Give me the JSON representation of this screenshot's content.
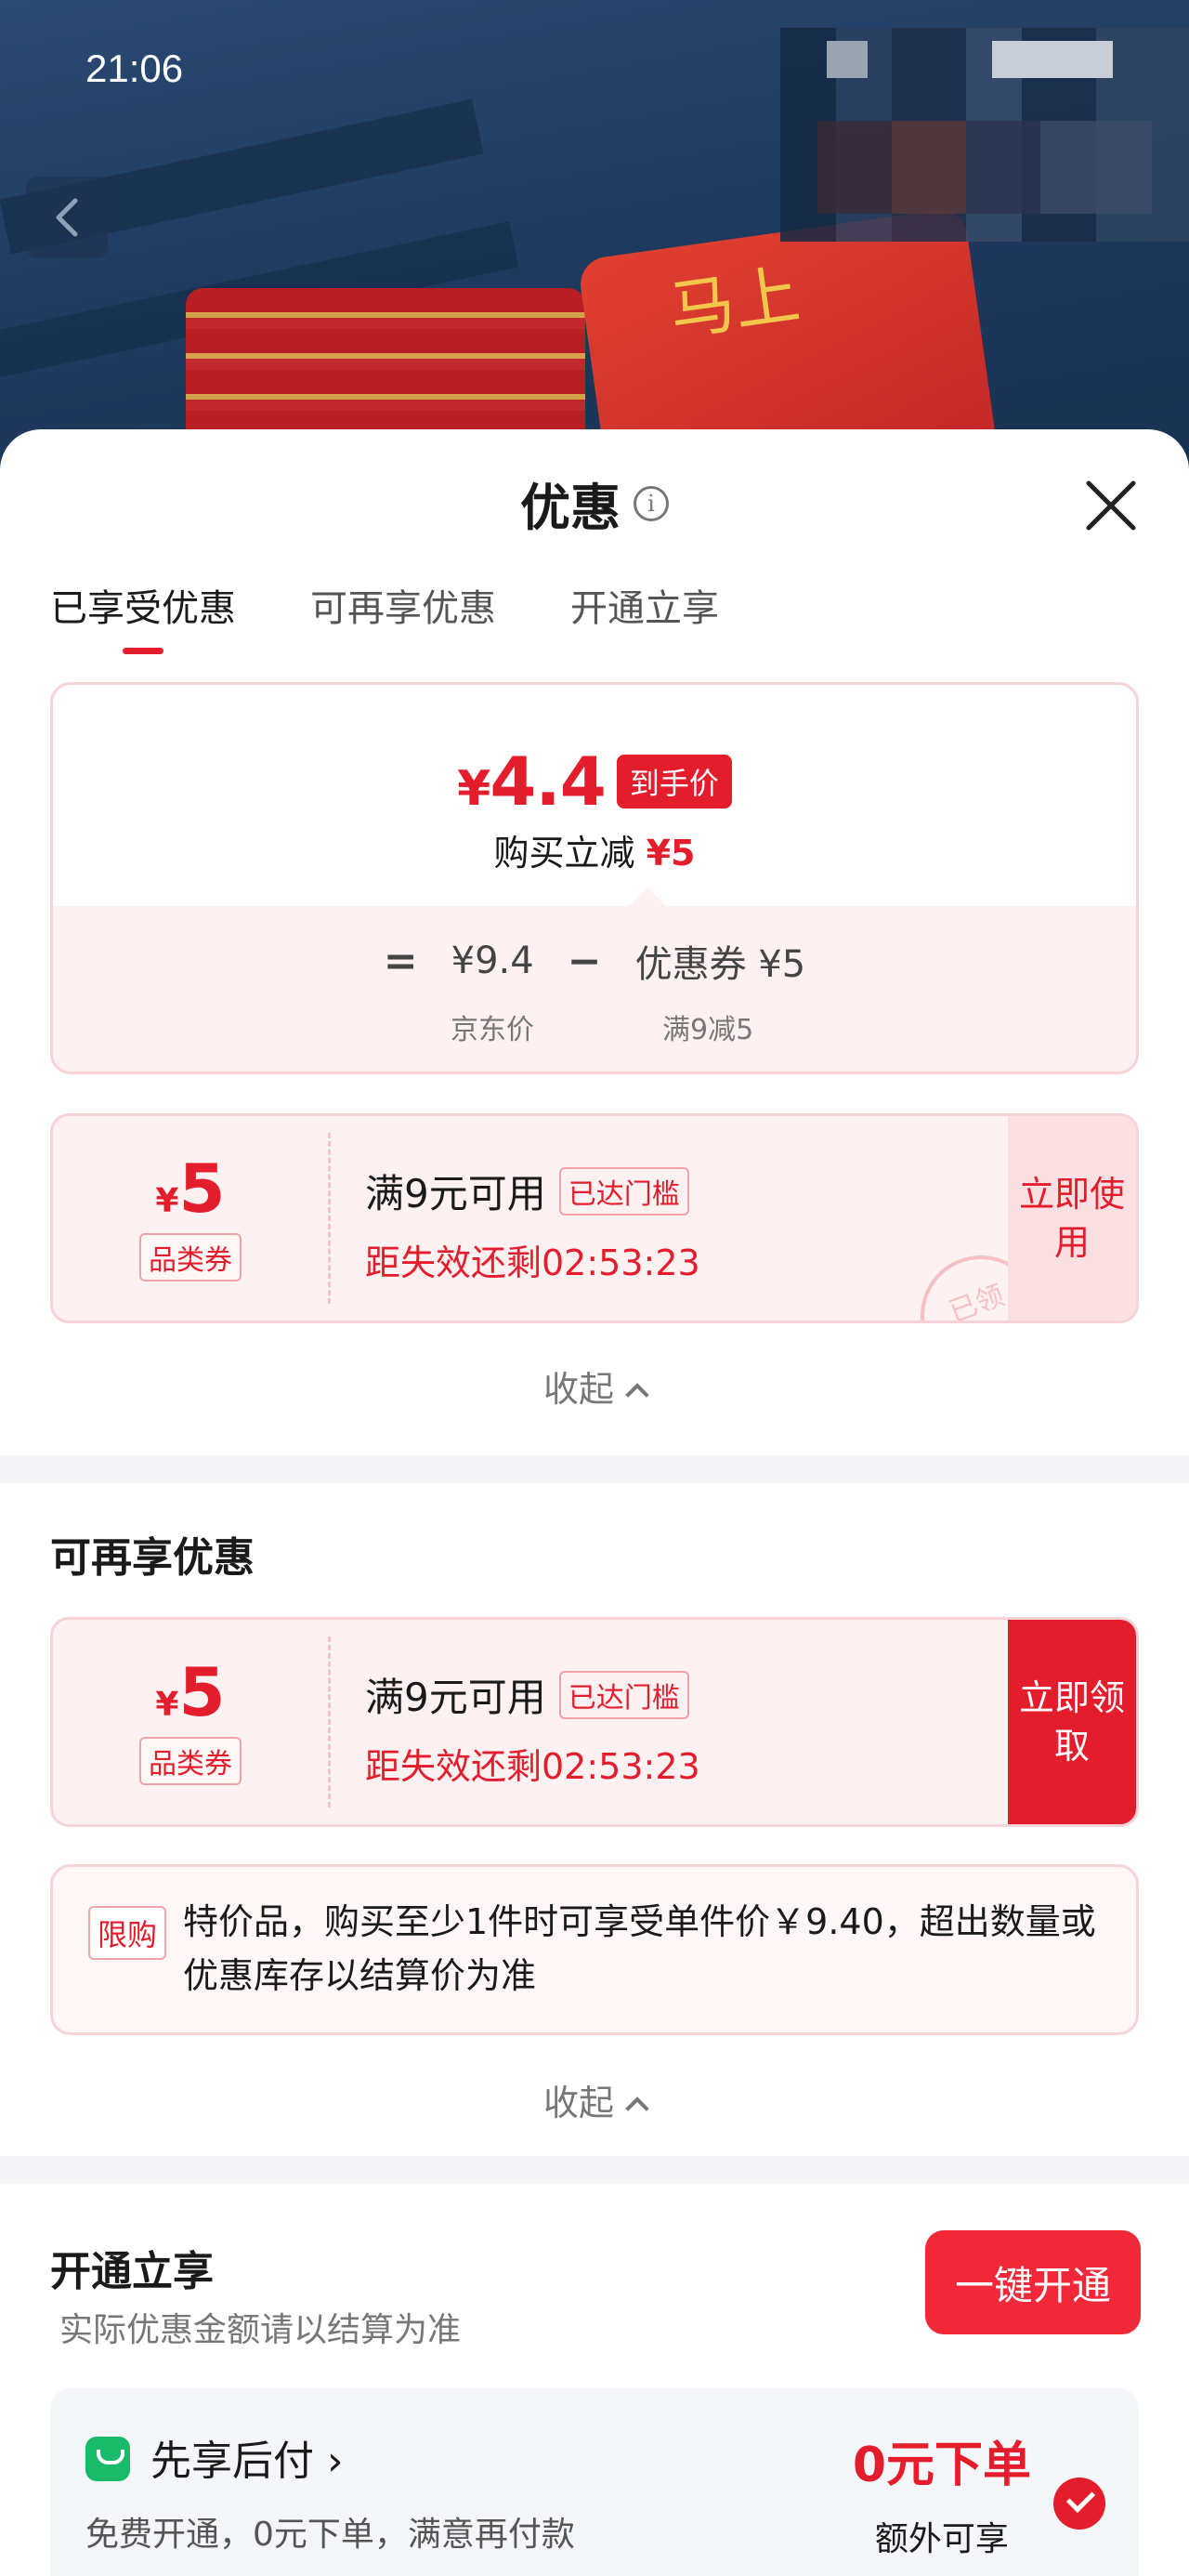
{
  "status": {
    "time": "21:06"
  },
  "hero": {
    "cup_text": "马上"
  },
  "sheet": {
    "title": "优惠",
    "tabs": [
      {
        "label": "已享受优惠",
        "active": true
      },
      {
        "label": "可再享优惠",
        "active": false
      },
      {
        "label": "开通立享",
        "active": false
      }
    ]
  },
  "summary": {
    "currency": "¥",
    "final_price": "4.4",
    "price_tag": "到手价",
    "reduce_label": "购买立减",
    "reduce_amount": "¥5",
    "equals": "=",
    "jd_price": "¥9.4",
    "minus": "−",
    "coupon_part": "优惠券 ¥5",
    "jd_price_label": "京东价",
    "coupon_rule": "满9减5"
  },
  "used_coupon": {
    "currency": "¥",
    "amount": "5",
    "category": "品类券",
    "condition": "满9元可用",
    "reached": "已达门槛",
    "expire": "距失效还剩02:53:23",
    "action": "立即使用",
    "stamp": "已领"
  },
  "collapse_label": "收起",
  "more": {
    "title": "可再享优惠",
    "coupon": {
      "currency": "¥",
      "amount": "5",
      "category": "品类券",
      "condition": "满9元可用",
      "reached": "已达门槛",
      "expire": "距失效还剩02:53:23",
      "action": "立即领取"
    },
    "limit_tag": "限购",
    "limit_text": "特价品，购买至少1件时可享受单件价￥9.40，超出数量或优惠库存以结算价为准"
  },
  "open": {
    "title": "开通立享",
    "subtitle": "实际优惠金额请以结算为准",
    "button": "一键开通",
    "pay_title": "先享后付 ›",
    "pay_desc": "免费开通，0元下单，满意再付款",
    "pay_big": "0元下单",
    "pay_small": "额外可享"
  },
  "colors": {
    "accent": "#e31d2b",
    "pay_green": "#1aba6b"
  }
}
